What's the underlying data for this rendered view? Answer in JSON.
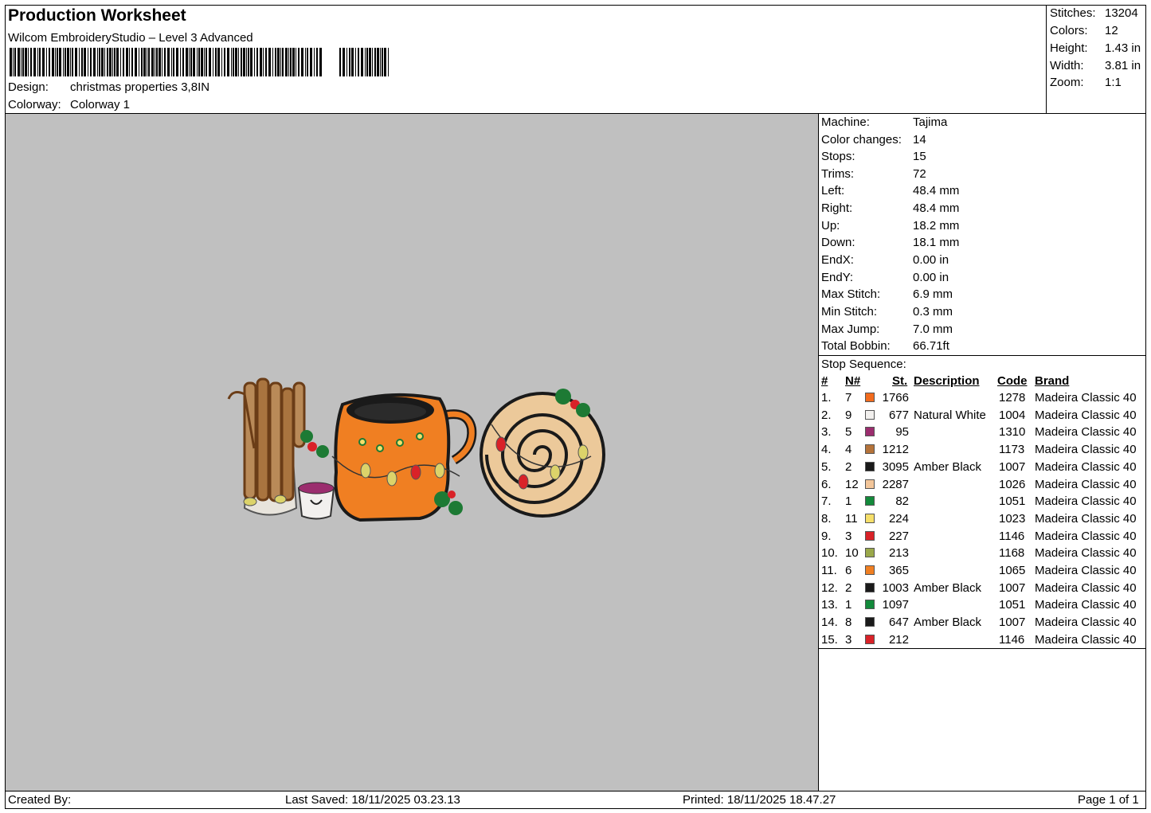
{
  "header": {
    "title": "Production Worksheet",
    "software": "Wilcom EmbroideryStudio – Level 3 Advanced",
    "design_label": "Design:",
    "design_value": "christmas properties 3,8IN",
    "colorway_label": "Colorway:",
    "colorway_value": "Colorway 1"
  },
  "stats": [
    {
      "label": "Stitches:",
      "value": "13204"
    },
    {
      "label": "Colors:",
      "value": "12"
    },
    {
      "label": "Height:",
      "value": "1.43 in"
    },
    {
      "label": "Width:",
      "value": "3.81 in"
    },
    {
      "label": "Zoom:",
      "value": "1:1"
    }
  ],
  "machine_info": [
    {
      "label": "Machine:",
      "value": "Tajima"
    },
    {
      "label": "Color changes:",
      "value": "14"
    },
    {
      "label": "Stops:",
      "value": "15"
    },
    {
      "label": "Trims:",
      "value": "72"
    },
    {
      "label": "Left:",
      "value": "48.4 mm"
    },
    {
      "label": "Right:",
      "value": "48.4 mm"
    },
    {
      "label": "Up:",
      "value": "18.2 mm"
    },
    {
      "label": "Down:",
      "value": "18.1 mm"
    },
    {
      "label": "EndX:",
      "value": "0.00 in"
    },
    {
      "label": "EndY:",
      "value": "0.00 in"
    },
    {
      "label": "Max Stitch:",
      "value": "6.9 mm"
    },
    {
      "label": "Min Stitch:",
      "value": "0.3 mm"
    },
    {
      "label": "Max Jump:",
      "value": "7.0 mm"
    },
    {
      "label": "Total Bobbin:",
      "value": "66.71ft"
    }
  ],
  "stop_sequence": {
    "title": "Stop Sequence:",
    "columns": [
      "#",
      "N#",
      "St.",
      "Description",
      "Code",
      "Brand"
    ],
    "rows": [
      {
        "idx": "1.",
        "n": "7",
        "color": "#f26b1d",
        "st": "1766",
        "desc": "",
        "code": "1278",
        "brand": "Madeira Classic 40"
      },
      {
        "idx": "2.",
        "n": "9",
        "color": "#f2f0ee",
        "st": "677",
        "desc": "Natural White",
        "code": "1004",
        "brand": "Madeira Classic 40"
      },
      {
        "idx": "3.",
        "n": "5",
        "color": "#9b2d6e",
        "st": "95",
        "desc": "",
        "code": "1310",
        "brand": "Madeira Classic 40"
      },
      {
        "idx": "4.",
        "n": "4",
        "color": "#b5733a",
        "st": "1212",
        "desc": "",
        "code": "1173",
        "brand": "Madeira Classic 40"
      },
      {
        "idx": "5.",
        "n": "2",
        "color": "#1a1a1a",
        "st": "3095",
        "desc": "Amber Black",
        "code": "1007",
        "brand": "Madeira Classic 40"
      },
      {
        "idx": "6.",
        "n": "12",
        "color": "#f3c69a",
        "st": "2287",
        "desc": "",
        "code": "1026",
        "brand": "Madeira Classic 40"
      },
      {
        "idx": "7.",
        "n": "1",
        "color": "#138a3b",
        "st": "82",
        "desc": "",
        "code": "1051",
        "brand": "Madeira Classic 40"
      },
      {
        "idx": "8.",
        "n": "11",
        "color": "#f6df6a",
        "st": "224",
        "desc": "",
        "code": "1023",
        "brand": "Madeira Classic 40"
      },
      {
        "idx": "9.",
        "n": "3",
        "color": "#d92228",
        "st": "227",
        "desc": "",
        "code": "1146",
        "brand": "Madeira Classic 40"
      },
      {
        "idx": "10.",
        "n": "10",
        "color": "#9aa84a",
        "st": "213",
        "desc": "",
        "code": "1168",
        "brand": "Madeira Classic 40"
      },
      {
        "idx": "11.",
        "n": "6",
        "color": "#f07f22",
        "st": "365",
        "desc": "",
        "code": "1065",
        "brand": "Madeira Classic 40"
      },
      {
        "idx": "12.",
        "n": "2",
        "color": "#1a1a1a",
        "st": "1003",
        "desc": "Amber Black",
        "code": "1007",
        "brand": "Madeira Classic 40"
      },
      {
        "idx": "13.",
        "n": "1",
        "color": "#138a3b",
        "st": "1097",
        "desc": "",
        "code": "1051",
        "brand": "Madeira Classic 40"
      },
      {
        "idx": "14.",
        "n": "8",
        "color": "#1a1a1a",
        "st": "647",
        "desc": "Amber Black",
        "code": "1007",
        "brand": "Madeira Classic 40"
      },
      {
        "idx": "15.",
        "n": "3",
        "color": "#d92228",
        "st": "212",
        "desc": "",
        "code": "1146",
        "brand": "Madeira Classic 40"
      }
    ]
  },
  "footer": {
    "created_by": "Created By:",
    "last_saved": "Last Saved: 18/11/2025 03.23.13",
    "printed": "Printed: 18/11/2025 18.47.27",
    "page": "Page 1 of 1"
  }
}
